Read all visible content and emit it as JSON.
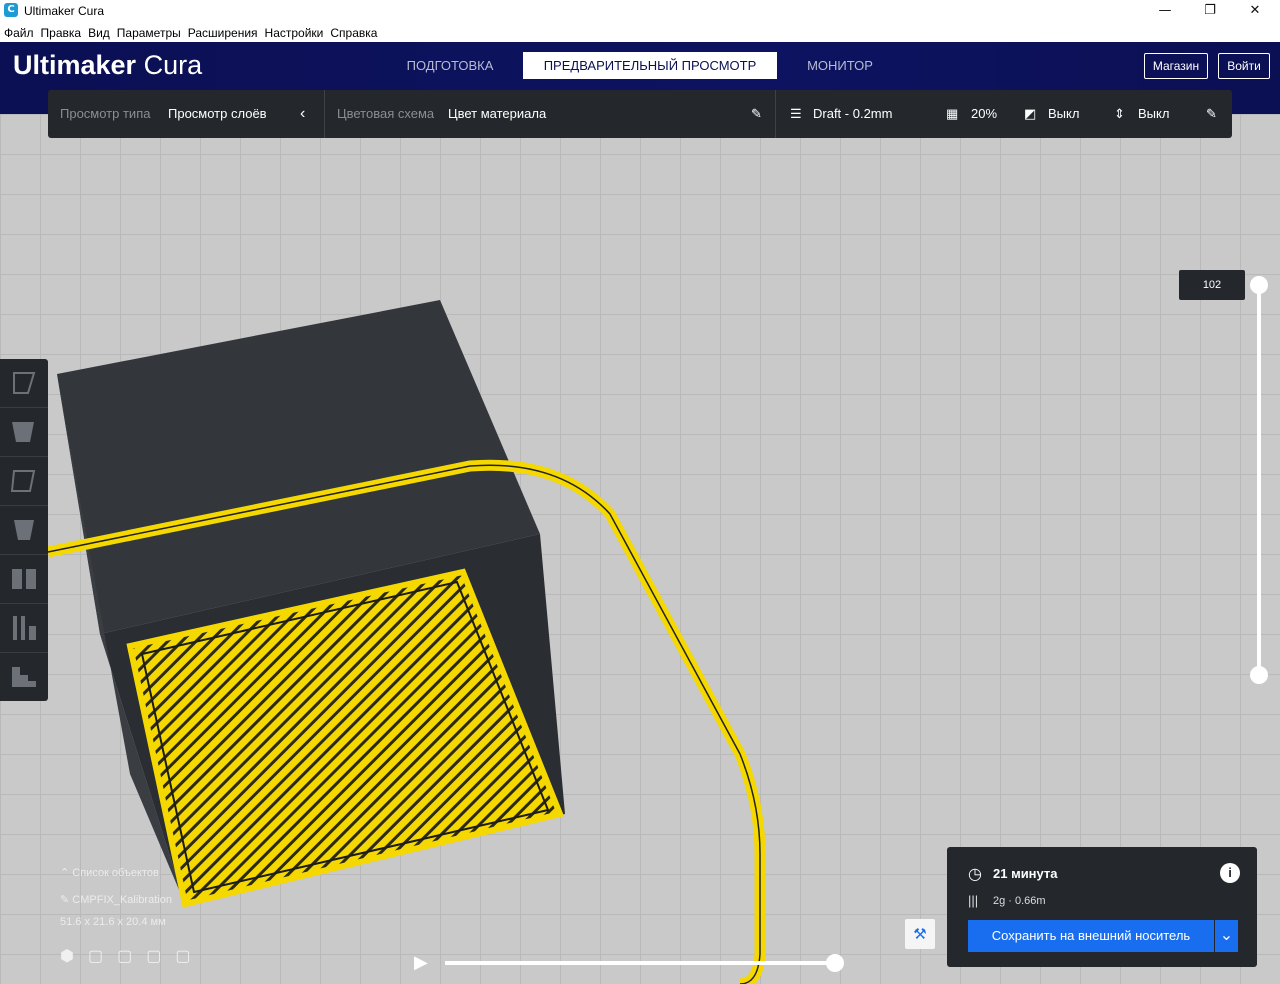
{
  "window": {
    "title": "Ultimaker Cura",
    "minimize_glyph": "—",
    "maximize_glyph": "❐",
    "close_glyph": "✕"
  },
  "menu": [
    "Файл",
    "Правка",
    "Вид",
    "Параметры",
    "Расширения",
    "Настройки",
    "Справка"
  ],
  "header": {
    "logo_bold": "Ultimaker",
    "logo_light": "Cura",
    "tabs": [
      "ПОДГОТОВКА",
      "ПРЕДВАРИТЕЛЬНЫЙ ПРОСМОТР",
      "МОНИТОР"
    ],
    "active_tab": "ПРЕДВАРИТЕЛЬНЫЙ ПРОСМОТР",
    "marketplace_label": "Магазин",
    "signin_label": "Войти"
  },
  "toolbar": {
    "view_type_label": "Просмотр типа",
    "view_type_value": "Просмотр слоёв",
    "color_scheme_label": "Цветовая схема",
    "color_scheme_value": "Цвет материала",
    "profile": "Draft - 0.2mm",
    "infill": "20%",
    "support": "Выкл",
    "adhesion": "Выкл"
  },
  "layer_slider": {
    "current_layer": "102",
    "position_fraction": 1.0
  },
  "object_list": {
    "header": "Список объектов",
    "object_name": "CMPFIX_Kalibration",
    "dimensions": "51.6 x 21.6 x 20.4 мм"
  },
  "playback": {
    "progress_fraction": 1.0
  },
  "print_info": {
    "time": "21 минута",
    "material": "2g · 0.66m",
    "save_label": "Сохранить на внешний носитель"
  },
  "colors": {
    "header_bg": "#0b1054",
    "toolbar_bg": "#24282d",
    "accent": "#196ef0",
    "filament": "#f5d800"
  }
}
